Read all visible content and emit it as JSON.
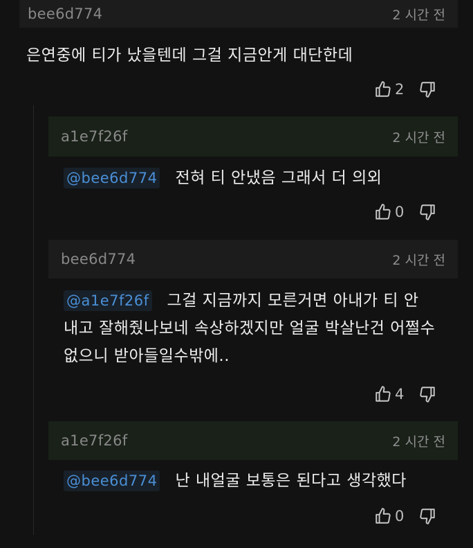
{
  "comments": [
    {
      "username": "bee6d774",
      "time": "2 시간 전",
      "mention": "",
      "text": "은연중에 티가 났을텐데 그걸 지금안게 대단한데",
      "likes": "2",
      "highlight": "",
      "header_bg": "#1c1c1c"
    },
    {
      "username": "a1e7f26f",
      "time": "2 시간 전",
      "mention": "@bee6d774",
      "text": "전혀 티 안냈음 그래서 더 의외",
      "likes": "0",
      "header_bg": "#192119"
    },
    {
      "username": "bee6d774",
      "time": "2 시간 전",
      "mention": "@a1e7f26f",
      "text_lines": [
        "그걸 지금까지 모른거면 아내가 티 안",
        "내고 잘해줬나보네 속상하겠지만 얼굴 박살난건 어쩔수",
        "없으니 받아들일수밖에.."
      ],
      "likes": "4",
      "header_bg": "#1c1c1c"
    },
    {
      "username": "a1e7f26f",
      "time": "2 시간 전",
      "mention": "@bee6d774",
      "text": "난 내얼굴 보통은 된다고 생각했다",
      "likes": "0",
      "header_bg": "#192119"
    }
  ],
  "icons": {
    "like": "thumbs-up-icon",
    "dislike": "thumbs-down-icon"
  }
}
